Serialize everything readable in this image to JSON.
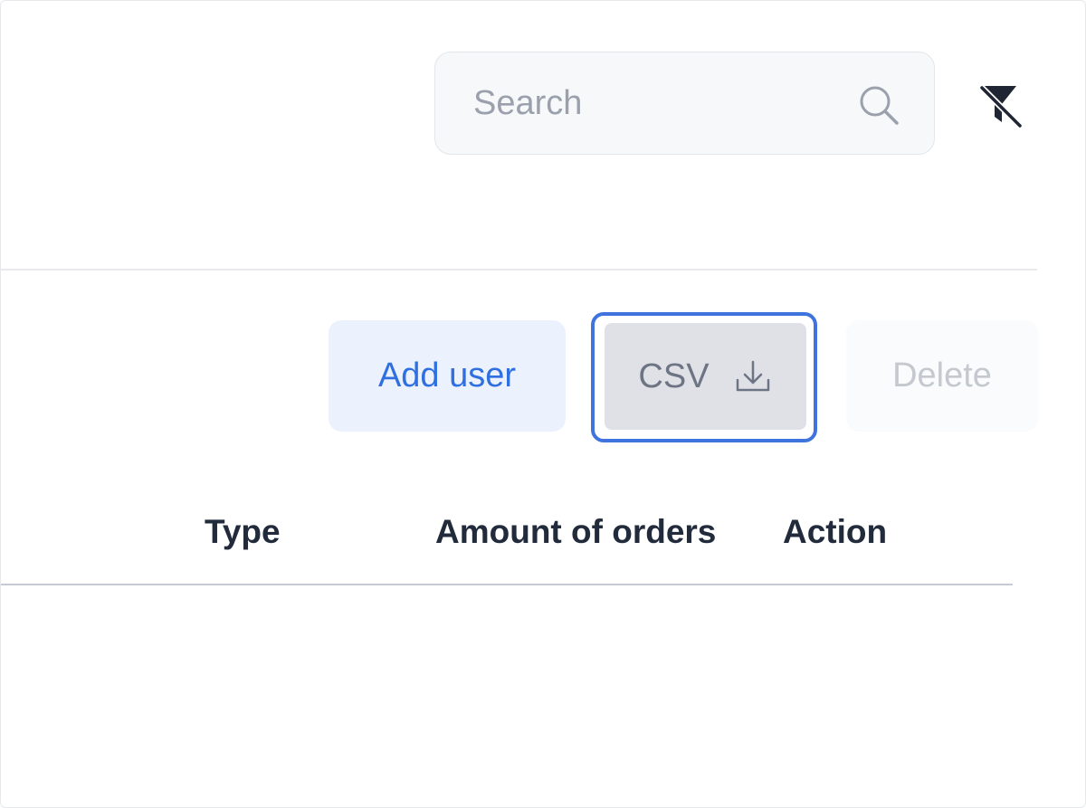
{
  "search": {
    "placeholder": "Search",
    "value": "",
    "icon": "search-icon"
  },
  "filter": {
    "icon": "filter-off-icon"
  },
  "toolbar": {
    "add_user_label": "Add user",
    "csv_label": "CSV",
    "csv_icon": "download-icon",
    "delete_label": "Delete",
    "delete_disabled": true
  },
  "table": {
    "columns": [
      "Type",
      "Amount of orders",
      "Action"
    ],
    "rows": []
  },
  "colors": {
    "accent": "#2f6fe0",
    "focus_ring": "#3f73dd",
    "add_button_bg": "#ebf2fd",
    "csv_button_bg": "#dfe1e6",
    "heading_text": "#222b3c"
  }
}
